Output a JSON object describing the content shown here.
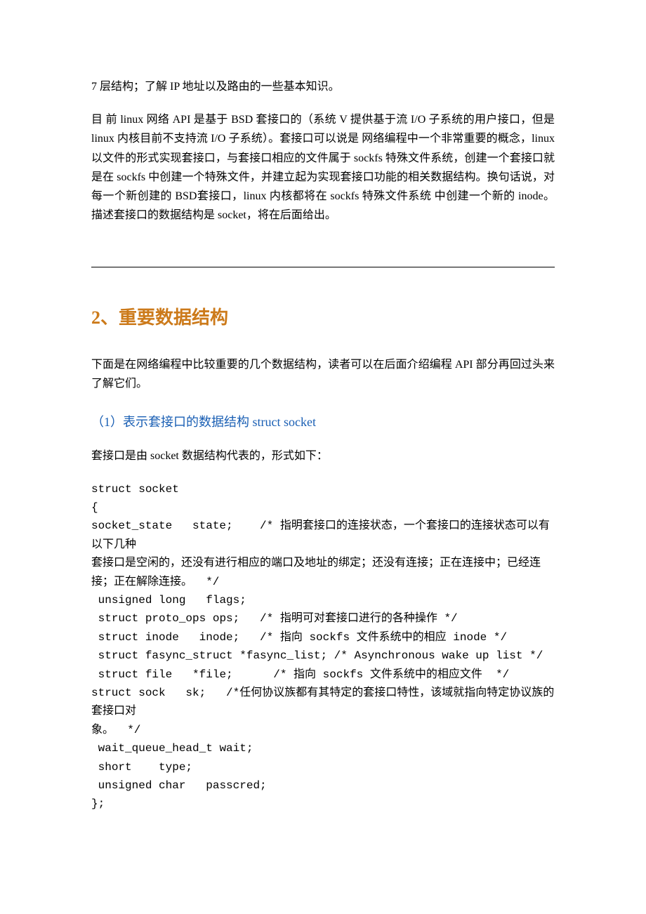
{
  "intro": {
    "line1": "7 层结构；了解 IP 地址以及路由的一些基本知识。",
    "para": "目 前 linux 网络 API 是基于 BSD 套接口的（系统 V 提供基于流 I/O 子系统的用户接口，但是 linux 内核目前不支持流 I/O 子系统）。套接口可以说是 网络编程中一个非常重要的概念，linux 以文件的形式实现套接口，与套接口相应的文件属于 sockfs 特殊文件系统，创建一个套接口就是在 sockfs 中创建一个特殊文件，并建立起为实现套接口功能的相关数据结构。换句话说，对每一个新创建的 BSD套接口，linux 内核都将在 sockfs 特殊文件系统 中创建一个新的 inode。描述套接口的数据结构是 socket，将在后面给出。"
  },
  "section2": {
    "title": "2、重要数据结构",
    "lede": "下面是在网络编程中比较重要的几个数据结构，读者可以在后面介绍编程 API 部分再回过头来了解它们。",
    "sub1": {
      "title": "（1）表示套接口的数据结构 struct socket",
      "lede": "套接口是由 socket 数据结构代表的，形式如下：",
      "code": "struct socket\n{\nsocket_state   state;    /* 指明套接口的连接状态，一个套接口的连接状态可以有以下几种\n套接口是空闲的，还没有进行相应的端口及地址的绑定；还没有连接；正在连接中；已经连接；正在解除连接。  */\n unsigned long   flags;\n struct proto_ops ops;   /* 指明可对套接口进行的各种操作 */\n struct inode   inode;   /* 指向 sockfs 文件系统中的相应 inode */\n struct fasync_struct *fasync_list; /* Asynchronous wake up list */\n struct file   *file;      /* 指向 sockfs 文件系统中的相应文件  */\nstruct sock   sk;   /*任何协议族都有其特定的套接口特性，该域就指向特定协议族的套接口对\n象。  */\n wait_queue_head_t wait;\n short    type;\n unsigned char   passcred;\n};"
    }
  }
}
